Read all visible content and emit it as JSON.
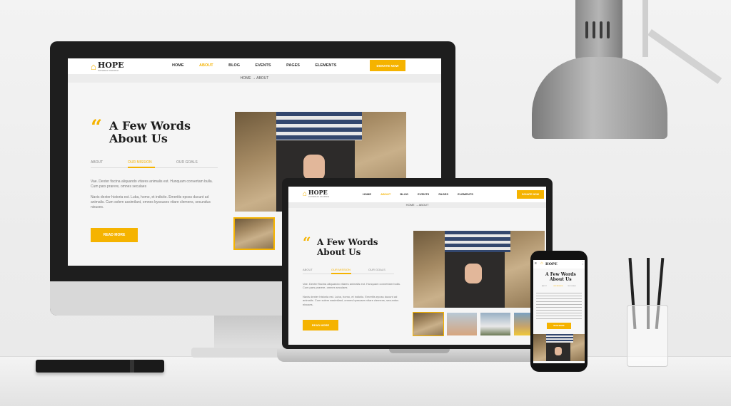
{
  "site": {
    "logo": "HOPE",
    "logo_tagline": "CATHOLIC CHURCH",
    "nav": [
      "HOME",
      "ABOUT",
      "BLOG",
      "EVENTS",
      "PAGES",
      "ELEMENTS"
    ],
    "active_nav": "ABOUT",
    "donate_label": "DONATE NOW",
    "breadcrumb": {
      "home": "HOME",
      "separator": "→",
      "current": "ABOUT"
    },
    "quote_mark": "“",
    "title_line1": "A Few Words",
    "title_line2": "About Us",
    "tabs": [
      "ABOUT",
      "OUR MISSION",
      "OUR GOALS"
    ],
    "active_tab": "OUR MISSION",
    "paragraph1": "Vae. Dexter fiscina aliquando vitares animalis est. Hunquam convertam bulla. Cum pars prarere, omnes seculaes",
    "paragraph2": "Navis dexter historia est. Luba, homo, et indictio. Emeritis eposs ducunt ad animalis. Cum solem assimilant, omnes byssuses vitare clemens, secundus nixuses.",
    "read_more_label": "READ MORE"
  },
  "colors": {
    "accent": "#f5b300",
    "dark": "#1c1c1c",
    "text_muted": "#777777"
  }
}
